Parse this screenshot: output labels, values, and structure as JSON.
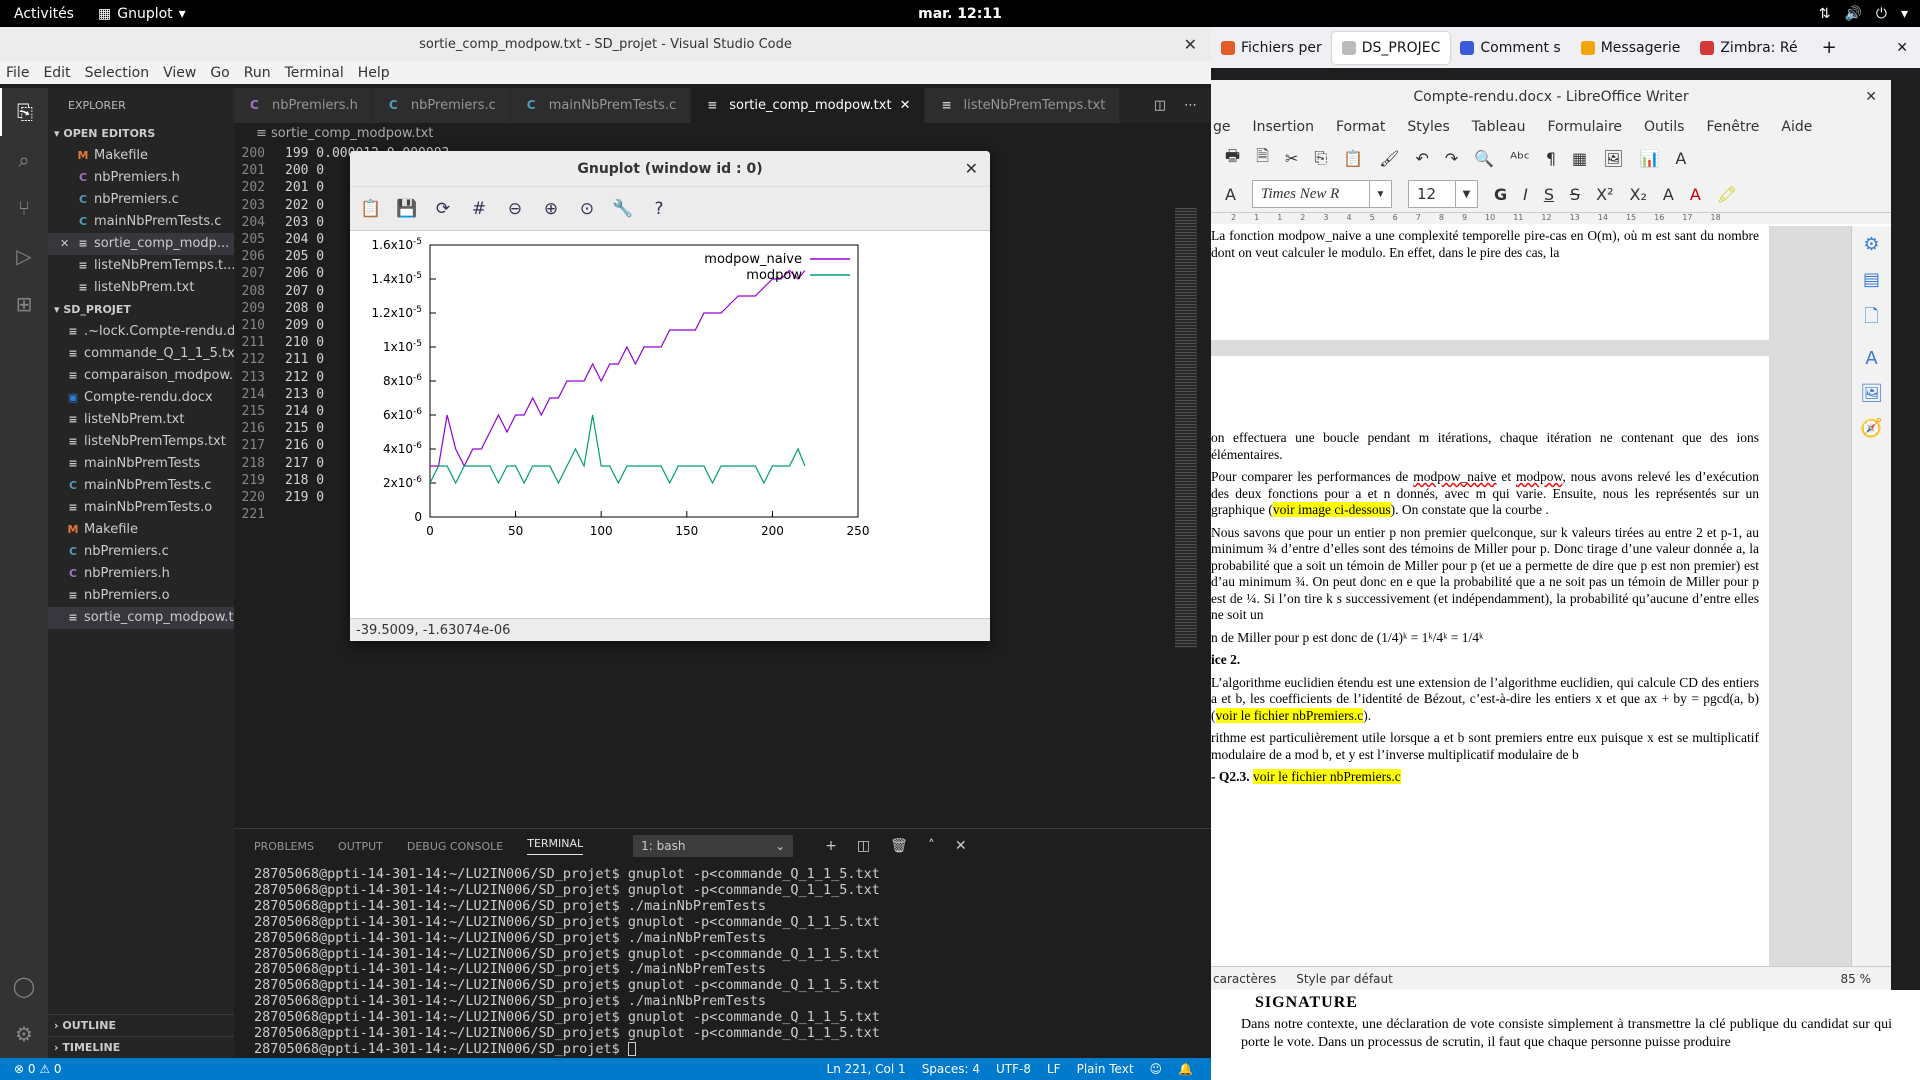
{
  "topbar": {
    "activities": "Activités",
    "app": "Gnuplot",
    "clock": "mar. 12:11"
  },
  "vscode": {
    "title": "sortie_comp_modpow.txt - SD_projet - Visual Studio Code",
    "menu": [
      "File",
      "Edit",
      "Selection",
      "View",
      "Go",
      "Run",
      "Terminal",
      "Help"
    ],
    "explorer_label": "EXPLORER",
    "open_editors_label": "OPEN EDITORS",
    "open_editors": [
      {
        "icon": "M",
        "kind": "m",
        "name": "Makefile"
      },
      {
        "icon": "C",
        "kind": "h",
        "name": "nbPremiers.h"
      },
      {
        "icon": "C",
        "kind": "c",
        "name": "nbPremiers.c"
      },
      {
        "icon": "C",
        "kind": "c",
        "name": "mainNbPremTests.c"
      },
      {
        "icon": "≡",
        "kind": "t",
        "name": "sortie_comp_modp..."
      },
      {
        "icon": "≡",
        "kind": "t",
        "name": "listeNbPremTemps.t..."
      },
      {
        "icon": "≡",
        "kind": "t",
        "name": "listeNbPrem.txt"
      }
    ],
    "project_label": "SD_PROJET",
    "files": [
      {
        "icon": "≡",
        "kind": "t",
        "name": ".~lock.Compte-rendu.d..."
      },
      {
        "icon": "≡",
        "kind": "t",
        "name": "commande_Q_1_1_5.txt"
      },
      {
        "icon": "≡",
        "kind": "t",
        "name": "comparaison_modpow.ps"
      },
      {
        "icon": "▣",
        "kind": "d",
        "name": "Compte-rendu.docx"
      },
      {
        "icon": "≡",
        "kind": "t",
        "name": "listeNbPrem.txt"
      },
      {
        "icon": "≡",
        "kind": "t",
        "name": "listeNbPremTemps.txt"
      },
      {
        "icon": "≡",
        "kind": "t",
        "name": "mainNbPremTests"
      },
      {
        "icon": "C",
        "kind": "c",
        "name": "mainNbPremTests.c"
      },
      {
        "icon": "≡",
        "kind": "t",
        "name": "mainNbPremTests.o"
      },
      {
        "icon": "M",
        "kind": "m",
        "name": "Makefile"
      },
      {
        "icon": "C",
        "kind": "c",
        "name": "nbPremiers.c"
      },
      {
        "icon": "C",
        "kind": "h",
        "name": "nbPremiers.h"
      },
      {
        "icon": "≡",
        "kind": "t",
        "name": "nbPremiers.o"
      },
      {
        "icon": "≡",
        "kind": "t",
        "name": "sortie_comp_modpow.txt"
      }
    ],
    "outline_label": "OUTLINE",
    "timeline_label": "TIMELINE",
    "tabs": [
      {
        "name": "nbPremiers.h",
        "kind": "h"
      },
      {
        "name": "nbPremiers.c",
        "kind": "c"
      },
      {
        "name": "mainNbPremTests.c",
        "kind": "c"
      },
      {
        "name": "sortie_comp_modpow.txt",
        "kind": "t"
      },
      {
        "name": "listeNbPremTemps.txt",
        "kind": "t"
      }
    ],
    "breadcrumb": "sortie_comp_modpow.txt",
    "code_lines": [
      {
        "n": "200",
        "t": "199 0.000012 0.000003"
      },
      {
        "n": "201",
        "t": "200 0"
      },
      {
        "n": "202",
        "t": "201 0"
      },
      {
        "n": "203",
        "t": "202 0"
      },
      {
        "n": "204",
        "t": "203 0"
      },
      {
        "n": "205",
        "t": "204 0"
      },
      {
        "n": "206",
        "t": "205 0"
      },
      {
        "n": "207",
        "t": "206 0"
      },
      {
        "n": "208",
        "t": "207 0"
      },
      {
        "n": "209",
        "t": "208 0"
      },
      {
        "n": "210",
        "t": "209 0"
      },
      {
        "n": "211",
        "t": "210 0"
      },
      {
        "n": "212",
        "t": "211 0"
      },
      {
        "n": "213",
        "t": "212 0"
      },
      {
        "n": "214",
        "t": "213 0"
      },
      {
        "n": "215",
        "t": "214 0"
      },
      {
        "n": "216",
        "t": "215 0"
      },
      {
        "n": "217",
        "t": "216 0"
      },
      {
        "n": "218",
        "t": "217 0"
      },
      {
        "n": "219",
        "t": "218 0"
      },
      {
        "n": "220",
        "t": "219 0"
      },
      {
        "n": "221",
        "t": ""
      }
    ],
    "panel_tabs": [
      "PROBLEMS",
      "OUTPUT",
      "DEBUG CONSOLE",
      "TERMINAL"
    ],
    "terminal_select": "1: bash",
    "terminal_lines": [
      "28705068@ppti-14-301-14:~/LU2IN006/SD_projet$ gnuplot -p<commande_Q_1_1_5.txt",
      "28705068@ppti-14-301-14:~/LU2IN006/SD_projet$ gnuplot -p<commande_Q_1_1_5.txt",
      "28705068@ppti-14-301-14:~/LU2IN006/SD_projet$ ./mainNbPremTests",
      "28705068@ppti-14-301-14:~/LU2IN006/SD_projet$ gnuplot -p<commande_Q_1_1_5.txt",
      "28705068@ppti-14-301-14:~/LU2IN006/SD_projet$ ./mainNbPremTests",
      "28705068@ppti-14-301-14:~/LU2IN006/SD_projet$ gnuplot -p<commande_Q_1_1_5.txt",
      "28705068@ppti-14-301-14:~/LU2IN006/SD_projet$ ./mainNbPremTests",
      "28705068@ppti-14-301-14:~/LU2IN006/SD_projet$ gnuplot -p<commande_Q_1_1_5.txt",
      "28705068@ppti-14-301-14:~/LU2IN006/SD_projet$ ./mainNbPremTests",
      "28705068@ppti-14-301-14:~/LU2IN006/SD_projet$ gnuplot -p<commande_Q_1_1_5.txt",
      "28705068@ppti-14-301-14:~/LU2IN006/SD_projet$ gnuplot -p<commande_Q_1_1_5.txt"
    ],
    "terminal_prompt": "28705068@ppti-14-301-14:~/LU2IN006/SD_projet$ ",
    "status_left": "⊗ 0 ⚠ 0",
    "status_right": [
      "Ln 221, Col 1",
      "Spaces: 4",
      "UTF-8",
      "LF",
      "Plain Text"
    ]
  },
  "gnuplot": {
    "title": "Gnuplot (window id : 0)",
    "status": "-39.5009, -1.63074e-06"
  },
  "chart_data": {
    "type": "line",
    "title": "",
    "xlabel": "",
    "ylabel": "",
    "xlim": [
      0,
      250
    ],
    "ylim": [
      0,
      1.6e-05
    ],
    "xticks": [
      "0",
      "50",
      "100",
      "150",
      "200",
      "250"
    ],
    "yticks": [
      "0",
      "2x10-6",
      "4x10-6",
      "6x10-6",
      "8x10-6",
      "1x10-5",
      "1.2x10-5",
      "1.4x10-5",
      "1.6x10-5"
    ],
    "grid": false,
    "legend_position": "top-right",
    "series": [
      {
        "name": "modpow_naive",
        "color": "#9400d3",
        "x": [
          0,
          5,
          10,
          15,
          20,
          25,
          30,
          35,
          40,
          45,
          50,
          55,
          60,
          65,
          70,
          75,
          80,
          85,
          90,
          95,
          100,
          105,
          110,
          115,
          120,
          125,
          130,
          135,
          140,
          145,
          150,
          155,
          160,
          165,
          170,
          175,
          180,
          185,
          190,
          195,
          200,
          205,
          210,
          215,
          219
        ],
        "y": [
          3e-06,
          3e-06,
          6e-06,
          4e-06,
          3e-06,
          4e-06,
          4e-06,
          5e-06,
          6e-06,
          5e-06,
          6e-06,
          6e-06,
          7e-06,
          6e-06,
          7e-06,
          7e-06,
          8e-06,
          8e-06,
          8e-06,
          9e-06,
          8e-06,
          9e-06,
          9e-06,
          1e-05,
          9e-06,
          1e-05,
          1e-05,
          1e-05,
          1.1e-05,
          1.1e-05,
          1.1e-05,
          1.1e-05,
          1.2e-05,
          1.2e-05,
          1.2e-05,
          1.25e-05,
          1.3e-05,
          1.3e-05,
          1.3e-05,
          1.35e-05,
          1.4e-05,
          1.4e-05,
          1.45e-05,
          1.4e-05,
          1.45e-05
        ]
      },
      {
        "name": "modpow",
        "color": "#009e73",
        "x": [
          0,
          5,
          10,
          15,
          20,
          25,
          30,
          35,
          40,
          45,
          50,
          55,
          60,
          65,
          70,
          75,
          80,
          85,
          90,
          95,
          100,
          105,
          110,
          115,
          120,
          125,
          130,
          135,
          140,
          145,
          150,
          155,
          160,
          165,
          170,
          175,
          180,
          185,
          190,
          195,
          200,
          205,
          210,
          215,
          219
        ],
        "y": [
          2e-06,
          3e-06,
          3e-06,
          2e-06,
          3e-06,
          3e-06,
          3e-06,
          3e-06,
          2e-06,
          3e-06,
          3e-06,
          2e-06,
          3e-06,
          3e-06,
          3e-06,
          2e-06,
          3e-06,
          4e-06,
          3e-06,
          6e-06,
          3e-06,
          3e-06,
          2e-06,
          3e-06,
          3e-06,
          3e-06,
          3e-06,
          3e-06,
          2e-06,
          3e-06,
          3e-06,
          3e-06,
          3e-06,
          2e-06,
          3e-06,
          3e-06,
          3e-06,
          3e-06,
          3e-06,
          2e-06,
          3e-06,
          3e-06,
          3e-06,
          4e-06,
          3e-06
        ]
      }
    ]
  },
  "browser": {
    "tabs": [
      {
        "label": "Fichiers per",
        "color": "#e35d2b"
      },
      {
        "label": "DS_PROJEC",
        "color": "",
        "active": true
      },
      {
        "label": "Comment s",
        "color": "#3b5bdb"
      },
      {
        "label": "Messagerie",
        "color": "#f0a500"
      },
      {
        "label": "Zimbra: Ré",
        "color": "#d63939"
      }
    ]
  },
  "writer": {
    "title": "Compte-rendu.docx - LibreOffice Writer",
    "menu": [
      "ge",
      "Insertion",
      "Format",
      "Styles",
      "Tableau",
      "Formulaire",
      "Outils",
      "Fenêtre",
      "Aide"
    ],
    "font_name": "Times New R",
    "font_size": "12",
    "page1_text": "La fonction modpow_naive a une complexité temporelle pire-cas en O(m), où m est sant du nombre dont on veut calculer le modulo. En effet, dans le pire des cas, la",
    "p1": "on effectuera une boucle pendant m itérations, chaque itération ne contenant que des ions élémentaires.",
    "p2a": "Pour comparer les performances de ",
    "p2_naive": "modpow_naive",
    "p2b": " et ",
    "p2_modpow": "modpow",
    "p2c": ", nous avons relevé les d’exécution des deux fonctions pour a et n donnés, avec m qui varie. Ensuite, nous les représentés sur un graphique (",
    "p2_link": "voir image ci-dessous",
    "p2d": "). On constate que la courbe .",
    "p3": "Nous savons que pour un entier p non premier quelconque, sur k valeurs tirées au entre 2 et p-1, au minimum ¾ d’entre d’elles sont des témoins de Miller pour p. Donc tirage d’une valeur donnée a, la probabilité que a soit un témoin de Miller pour p (et ue a permette de dire que p est non premier) est d’au minimum ¾. On peut donc en e que la probabilité que a ne soit pas un témoin de Miller pour p est de ¼. Si l’on tire k s successivement (et indépendamment), la probabilité qu’aucune d’entre elles ne soit un",
    "p4": "n de Miller pour p est donc de",
    "formula": "(1/4)ᵏ = 1ᵏ/4ᵏ = 1/4ᵏ",
    "heading": "ice 2.",
    "p5a": "L’algorithme euclidien étendu est une extension de l’algorithme euclidien, qui calcule CD des entiers a et b, les coefficients de l’identité de Bézout, c’est-à-dire les entiers x et que ax + by = pgcd(a, b) (",
    "p5_link": "voir le fichier nbPremiers.c",
    "p5b": ").",
    "p6": "rithme est particulièrement utile lorsque a et b sont premiers entre eux puisque x est se multiplicatif modulaire de a mod b, et y est l’inverse multiplicatif modulaire de b",
    "q23": "- Q2.3.",
    "q23_link": "voir le fichier nbPremiers.c",
    "status_chars": "caractères",
    "status_style": "Style par défaut",
    "zoom": "85 %"
  },
  "below": {
    "signature": "SIGNATURE",
    "text": "Dans notre contexte, une déclaration de vote consiste simplement à transmettre la clé publique du candidat sur qui porte le vote. Dans un processus de scrutin, il faut que chaque personne puisse produire"
  }
}
